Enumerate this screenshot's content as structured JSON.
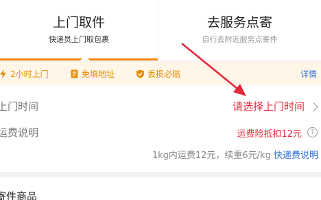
{
  "tabs": [
    {
      "title": "上门取件",
      "subtitle": "快递员上门取包裹"
    },
    {
      "title": "去服务点寄",
      "subtitle": "自行去附近服务点寄件"
    }
  ],
  "features": {
    "items": [
      {
        "label": "2小时上门",
        "icon": "lightning-icon"
      },
      {
        "label": "免填地址",
        "icon": "document-icon"
      },
      {
        "label": "丢损必赔",
        "icon": "shield-check-icon"
      }
    ],
    "details_label": "详情"
  },
  "pickup_time": {
    "label": "上门时间",
    "value": "请选择上门时间"
  },
  "shipping_fee": {
    "label": "运费说明",
    "value": "运费险抵扣12元",
    "note": "1kg内运费12元，续重6元/kg",
    "note_link": "快递费说明"
  },
  "goods": {
    "title": "寄件商品"
  },
  "colors": {
    "accent": "#f5840c",
    "red": "#e6263b",
    "link": "#2f6fd6",
    "feature": "#e68b00"
  }
}
